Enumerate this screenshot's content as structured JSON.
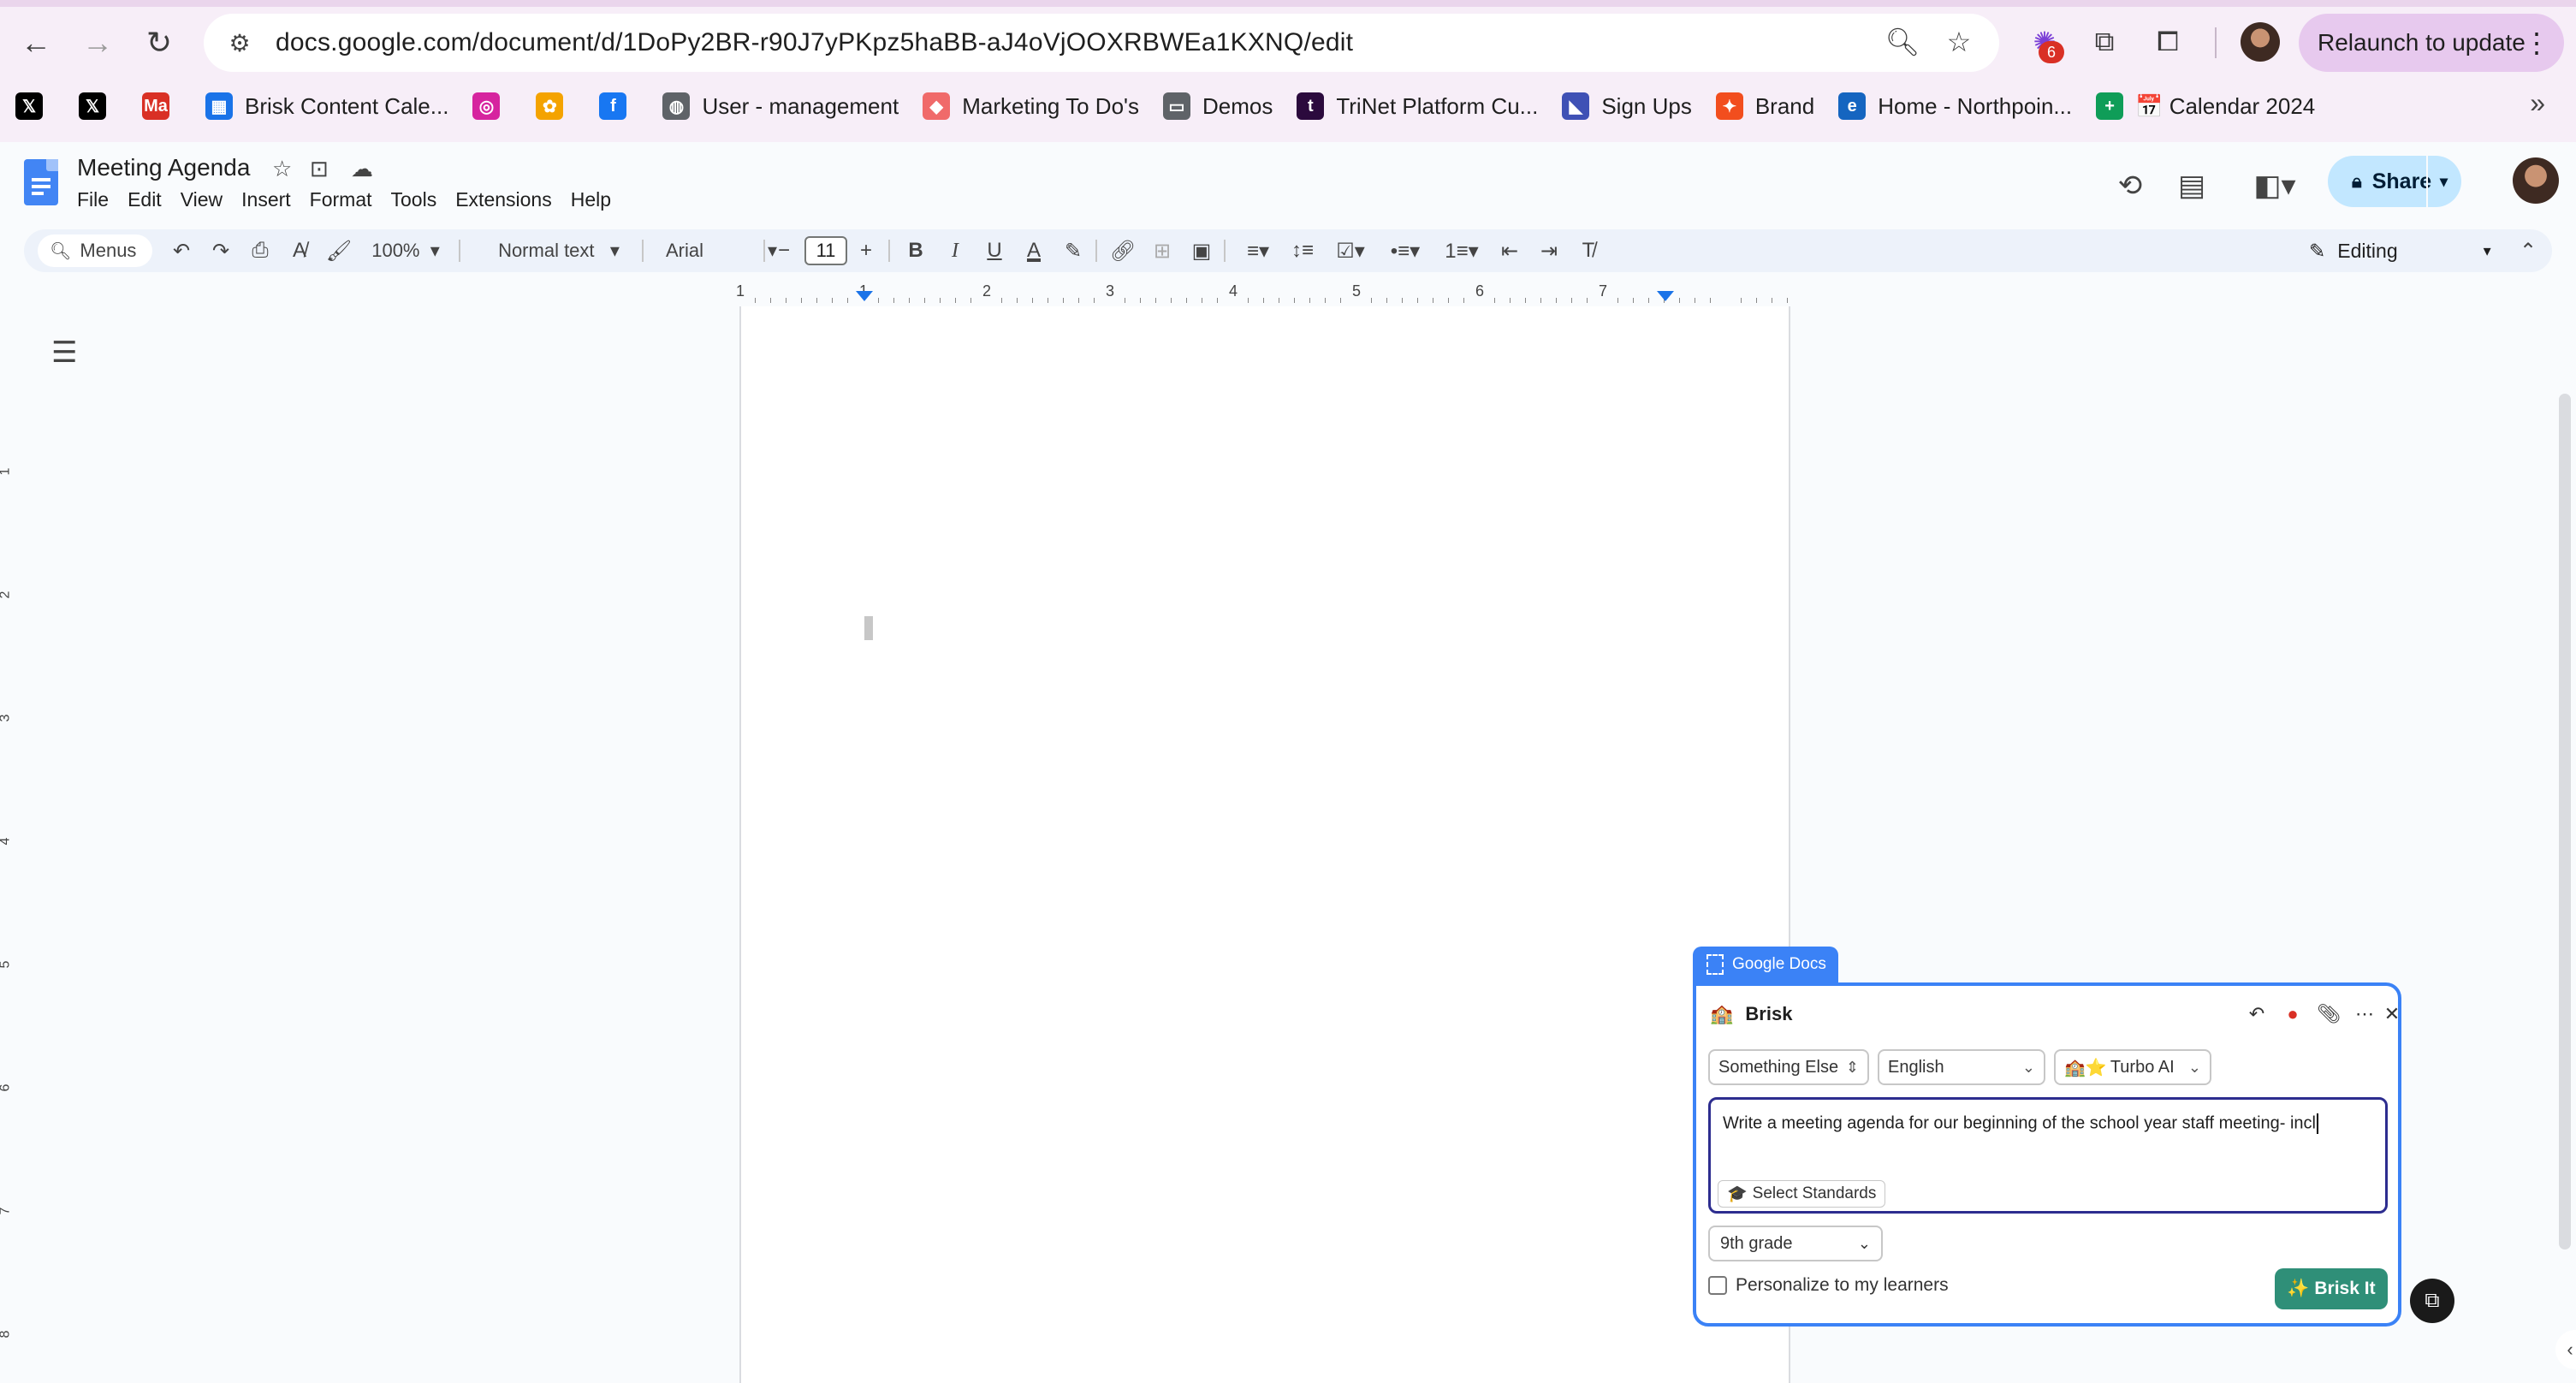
{
  "browser": {
    "url": "docs.google.com/document/d/1DoPy2BR-r90J7yPKpz5haBB-aJ4oVjOOXRBWEa1KXNQ/edit",
    "relaunch_label": "Relaunch to update",
    "extension_badge": "6",
    "bookmarks": [
      {
        "label": "",
        "icon": "x-icon",
        "color": "#000000",
        "glyph": "𝕏"
      },
      {
        "label": "",
        "icon": "x-icon",
        "color": "#000000",
        "glyph": "𝕏"
      },
      {
        "label": "",
        "icon": "marketo-icon",
        "color": "#d93025",
        "glyph": "Ma"
      },
      {
        "label": "Brisk Content Cale...",
        "icon": "calendar-icon",
        "color": "#1a73e8",
        "glyph": "▦"
      },
      {
        "label": "",
        "icon": "instagram-icon",
        "color": "#d6249f",
        "glyph": "◎"
      },
      {
        "label": "",
        "icon": "brand-icon",
        "color": "#f4a300",
        "glyph": "✿"
      },
      {
        "label": "",
        "icon": "facebook-icon",
        "color": "#1877f2",
        "glyph": "f"
      },
      {
        "label": "User - management",
        "icon": "globe-icon",
        "color": "#5f6368",
        "glyph": "◍"
      },
      {
        "label": "Marketing To Do's",
        "icon": "asana-icon",
        "color": "#f06a6a",
        "glyph": "◆"
      },
      {
        "label": "Demos",
        "icon": "folder-icon",
        "color": "#5f6368",
        "glyph": "▭"
      },
      {
        "label": "TriNet Platform Cu...",
        "icon": "trinet-icon",
        "color": "#2b0a3d",
        "glyph": "t"
      },
      {
        "label": "Sign Ups",
        "icon": "signup-icon",
        "color": "#3f51b5",
        "glyph": "◣"
      },
      {
        "label": "Brand",
        "icon": "figma-icon",
        "color": "#f24e1e",
        "glyph": "✦"
      },
      {
        "label": "Home - Northpoin...",
        "icon": "northpoint-icon",
        "color": "#1565c0",
        "glyph": "e"
      },
      {
        "label": "📅 Calendar 2024",
        "icon": "sheets-icon",
        "color": "#0f9d58",
        "glyph": "+"
      }
    ]
  },
  "doc": {
    "title": "Meeting Agenda",
    "menus": [
      "File",
      "Edit",
      "View",
      "Insert",
      "Format",
      "Tools",
      "Extensions",
      "Help"
    ],
    "share_label": "Share"
  },
  "toolbar": {
    "menus_label": "Menus",
    "zoom": "100%",
    "style": "Normal text",
    "font": "Arial",
    "font_size": "11",
    "mode": "Editing"
  },
  "ruler": {
    "marks": [
      "1",
      "1",
      "2",
      "3",
      "4",
      "5",
      "6",
      "7"
    ]
  },
  "vruler": {
    "marks": [
      "1",
      "2",
      "3",
      "4",
      "5",
      "6",
      "7",
      "8"
    ]
  },
  "brisk": {
    "tab_label": "Google Docs",
    "title": "Brisk",
    "type_select": "Something Else",
    "language_select": "English",
    "model_select": "Turbo AI",
    "model_prefix": "🏫⭐",
    "prompt_text": "Write a meeting agenda for our beginning of the school year staff meeting- incl",
    "standards_label": "Select Standards",
    "grade_select": "9th grade",
    "personalize_label": "Personalize to my learners",
    "submit_label": "✨ Brisk It"
  }
}
